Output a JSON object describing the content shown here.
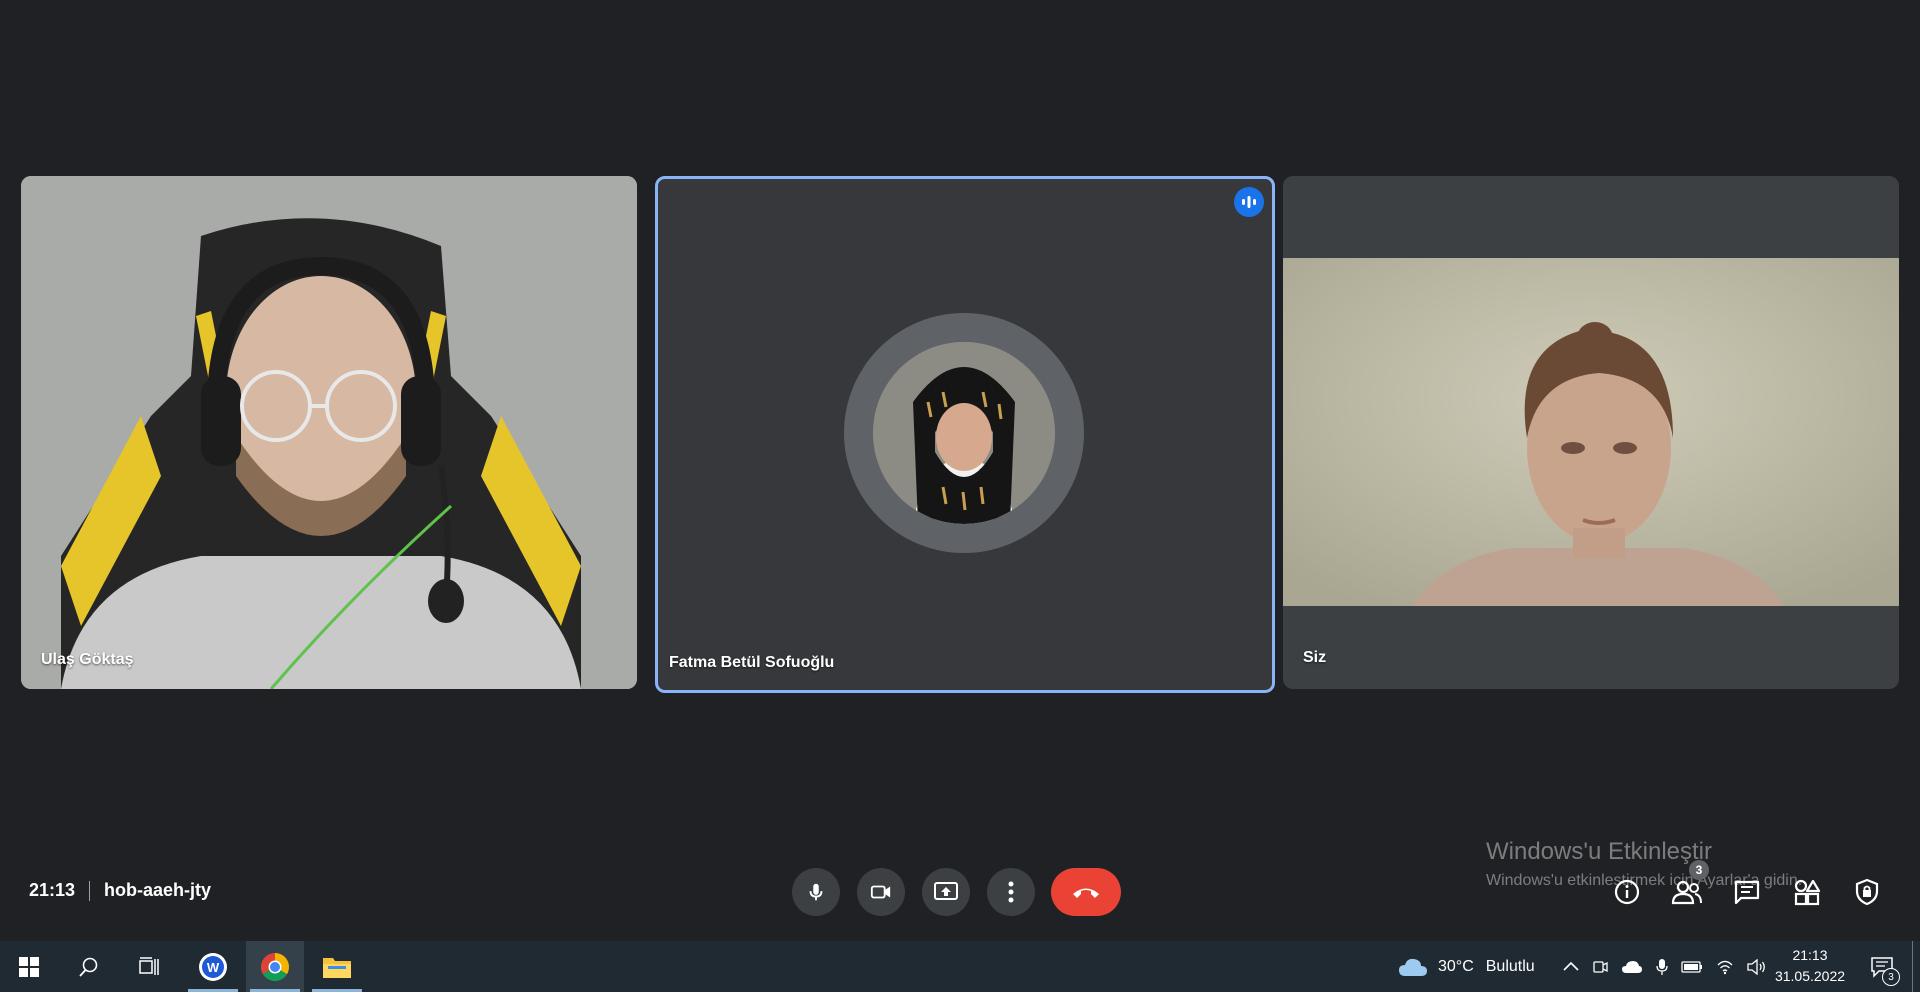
{
  "meeting": {
    "time": "21:13",
    "code": "hob-aaeh-jty"
  },
  "participants": [
    {
      "name": "Ulaş Göktaş"
    },
    {
      "name": "Fatma Betül Sofuoğlu",
      "speaking": true
    },
    {
      "name": "Siz"
    }
  ],
  "controls": {
    "mic": "mic-icon",
    "camera": "camera-icon",
    "present": "present-screen-icon",
    "more": "more-options-icon",
    "hangup": "hang-up-icon"
  },
  "side_panel": {
    "people_count": "3"
  },
  "watermark": {
    "title": "Windows'u Etkinleştir",
    "subtitle": "Windows'u etkinleştirmek için Ayarlar'a gidin."
  },
  "taskbar": {
    "weather_temp": "30°C",
    "weather_desc": "Bulutlu",
    "clock_time": "21:13",
    "clock_date": "31.05.2022",
    "notification_count": "3"
  },
  "colors": {
    "background": "#202124",
    "speaking_border": "#8ab4f8",
    "hangup": "#ea4335",
    "taskbar": "#1f2a33"
  }
}
